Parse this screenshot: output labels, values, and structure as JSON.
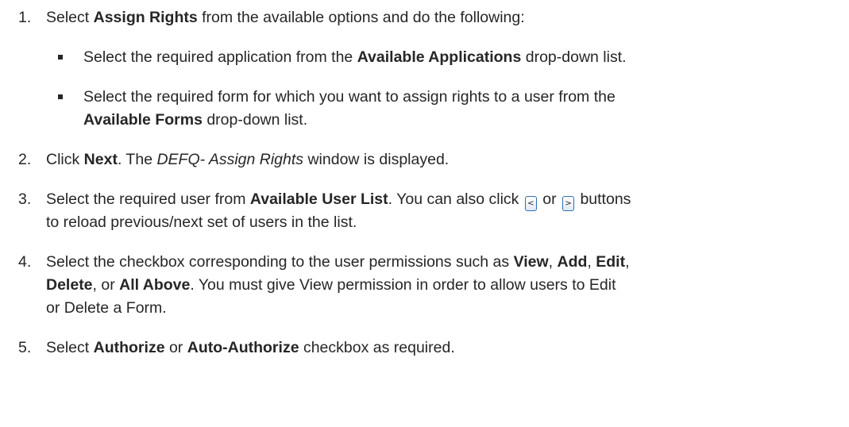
{
  "steps": [
    {
      "number": "1.",
      "t1": "Select ",
      "b1": "Assign Rights",
      "t2": " from the available options and do the following:",
      "subitems": [
        {
          "t1": "Select the required application from the ",
          "b1": "Available Applications",
          "t2": " drop-down list."
        },
        {
          "line1": "Select the required form for which you want to assign rights to a user from the",
          "b1": "Available Forms",
          "t2": " drop-down list."
        }
      ]
    },
    {
      "number": "2.",
      "t1": "Click ",
      "b1": "Next",
      "t2": ". The ",
      "i1": "DEFQ- Assign Rights",
      "t3": " window is displayed."
    },
    {
      "number": "3.",
      "t1": "Select the required user from ",
      "b1": "Available User List",
      "t2": ". You can also click ",
      "prev_icon": "<",
      "t3": " or ",
      "next_icon": ">",
      "t4": " buttons",
      "line2": "to reload previous/next set of users in the list."
    },
    {
      "number": "4.",
      "t1": "Select the checkbox corresponding to the user permissions such as ",
      "b1": "View",
      "t2": ", ",
      "b2": "Add",
      "t3": ", ",
      "b3": "Edit",
      "t4": ",",
      "b4": "Delete",
      "t5": ", or ",
      "b5": "All Above",
      "t6": ". You must give View permission in order to allow users to Edit",
      "line3": "or Delete a Form."
    },
    {
      "number": "5.",
      "t1": "Select ",
      "b1": "Authorize",
      "t2": " or ",
      "b2": "Auto-Authorize",
      "t3": " checkbox as required."
    }
  ]
}
